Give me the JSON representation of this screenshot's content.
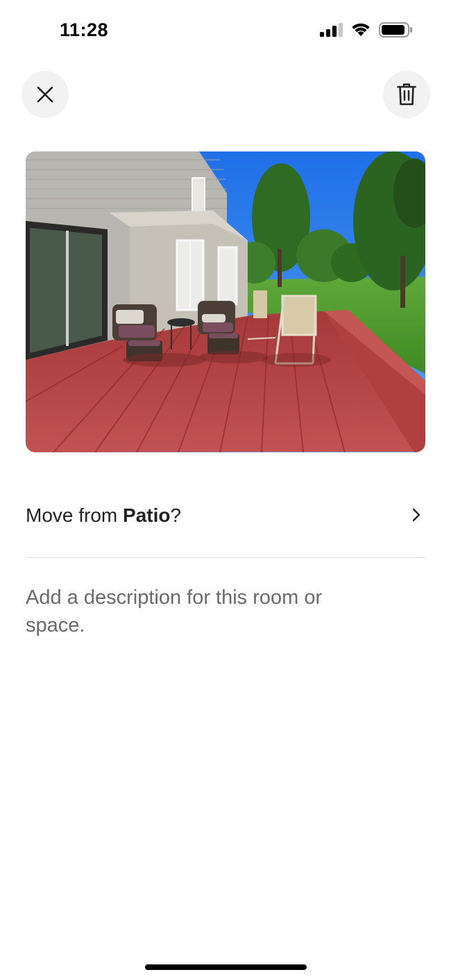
{
  "status_bar": {
    "time": "11:28",
    "signal_icon": "cellular-signal-icon",
    "wifi_icon": "wifi-icon",
    "battery_icon": "battery-icon"
  },
  "header": {
    "close_icon": "close-icon",
    "delete_icon": "trash-icon"
  },
  "photo": {
    "subject": "patio-deck-photo"
  },
  "move_row": {
    "prefix": "Move from ",
    "room": "Patio",
    "suffix": "?",
    "chevron_icon": "chevron-right-icon"
  },
  "description": {
    "placeholder": "Add a description for this room or space."
  },
  "colors": {
    "icon_button_bg": "#f2f2f2",
    "text_primary": "#222222",
    "text_placeholder": "#6a6a6a",
    "divider": "#dddddd"
  }
}
